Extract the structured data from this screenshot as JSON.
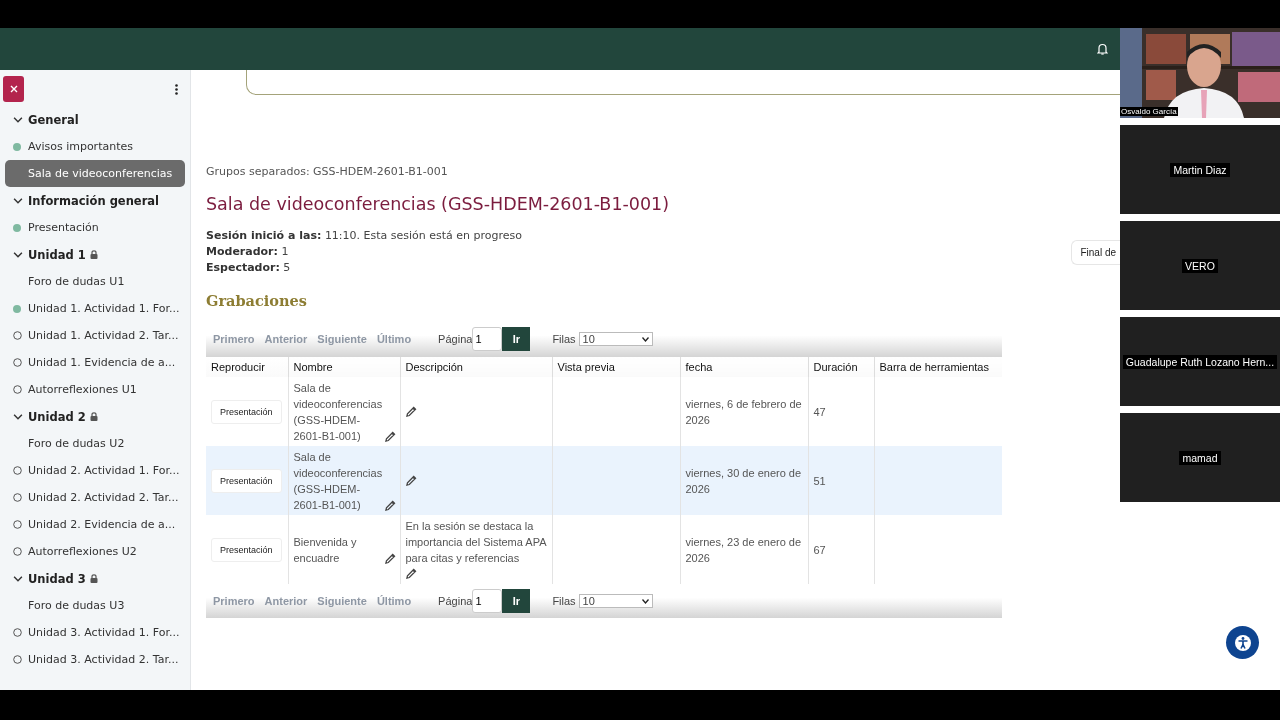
{
  "sidebar": {
    "sections": [
      {
        "title": "General",
        "expanded": true,
        "locked": false,
        "items": [
          {
            "label": "Avisos importantes",
            "kind": "completed",
            "selected": false
          },
          {
            "label": "Sala de videoconferencias",
            "kind": "plain",
            "selected": true
          }
        ]
      },
      {
        "title": "Información general",
        "expanded": true,
        "locked": false,
        "items": [
          {
            "label": "Presentación",
            "kind": "completed",
            "selected": false
          }
        ]
      },
      {
        "title": "Unidad 1",
        "expanded": true,
        "locked": true,
        "items": [
          {
            "label": "Foro de dudas U1",
            "kind": "plain",
            "selected": false
          },
          {
            "label": "Unidad 1. Actividad 1. For...",
            "kind": "completed",
            "selected": false
          },
          {
            "label": "Unidad 1. Actividad 2. Tar...",
            "kind": "pending",
            "selected": false
          },
          {
            "label": "Unidad 1. Evidencia de a...",
            "kind": "pending",
            "selected": false
          },
          {
            "label": "Autorreflexiones U1",
            "kind": "pending",
            "selected": false
          }
        ]
      },
      {
        "title": "Unidad 2",
        "expanded": true,
        "locked": true,
        "items": [
          {
            "label": "Foro de dudas U2",
            "kind": "plain",
            "selected": false
          },
          {
            "label": "Unidad 2. Actividad 1. For...",
            "kind": "pending",
            "selected": false
          },
          {
            "label": "Unidad 2. Actividad 2. Tar...",
            "kind": "pending",
            "selected": false
          },
          {
            "label": "Unidad 2. Evidencia de a...",
            "kind": "pending",
            "selected": false
          },
          {
            "label": "Autorreflexiones U2",
            "kind": "pending",
            "selected": false
          }
        ]
      },
      {
        "title": "Unidad 3",
        "expanded": true,
        "locked": true,
        "items": [
          {
            "label": "Foro de dudas U3",
            "kind": "plain",
            "selected": false
          },
          {
            "label": "Unidad 3. Actividad 1. For...",
            "kind": "pending",
            "selected": false
          },
          {
            "label": "Unidad 3. Actividad 2. Tar...",
            "kind": "pending",
            "selected": false
          }
        ]
      }
    ]
  },
  "main": {
    "groups": "Grupos separados: GSS-HDEM-2601-B1-001",
    "title": "Sala de videoconferencias (GSS-HDEM-2601-B1-001)",
    "info": [
      {
        "label": "Sesión inició a las:",
        "value": "11:10. Esta sesión está en progreso"
      },
      {
        "label": "Moderador:",
        "value": "1"
      },
      {
        "label": "Espectador:",
        "value": "5"
      }
    ],
    "side_button": "Final de",
    "recordings_heading": "Grabaciones",
    "pagination": [
      {
        "links": [
          {
            "label": "Primero",
            "disabled": true
          },
          {
            "label": "Anterior",
            "disabled": true
          },
          {
            "label": "Siguiente",
            "disabled": true
          },
          {
            "label": "Último",
            "disabled": true
          }
        ],
        "page_label": "Página",
        "page": "1",
        "go": "Ir",
        "rows_label": "Filas",
        "rows": "10"
      },
      {
        "links": [
          {
            "label": "Primero",
            "disabled": true
          },
          {
            "label": "Anterior",
            "disabled": true
          },
          {
            "label": "Siguiente",
            "disabled": true
          },
          {
            "label": "Último",
            "disabled": true
          }
        ],
        "page_label": "Página",
        "page": "1",
        "go": "Ir",
        "rows_label": "Filas",
        "rows": "10"
      }
    ],
    "table": {
      "columns": [
        "Reproducir",
        "Nombre",
        "Descripción",
        "Vista previa",
        "fecha",
        "Duración",
        "Barra de herramientas"
      ],
      "rows": [
        {
          "play": "Presentación",
          "name": "Sala de videoconferencias (GSS-HDEM-2601-B1-001)",
          "date": "viernes, 6 de febrero de 2026",
          "duration": "47",
          "selected": false
        },
        {
          "play": "Presentación",
          "name": "Sala de videoconferencias (GSS-HDEM-2601-B1-001)",
          "date": "viernes, 30 de enero de 2026",
          "duration": "51",
          "selected": true
        },
        {
          "play": "Presentación",
          "name": "Bienvenida y encuadre",
          "description": "En la sesión se destaca la importancia del Sistema APA para citas y referencias",
          "date": "viernes, 23 de enero de 2026",
          "duration": "67",
          "selected": false
        }
      ]
    }
  },
  "participants": [
    {
      "name": "Osvaldo García",
      "kind": "video"
    },
    {
      "name": "Martin Diaz",
      "kind": "camera-off"
    },
    {
      "name": "VERO",
      "kind": "camera-off"
    },
    {
      "name": "Guadalupe Ruth Lozano Hern...",
      "kind": "camera-off"
    },
    {
      "name": "mamad",
      "kind": "camera-off"
    }
  ]
}
